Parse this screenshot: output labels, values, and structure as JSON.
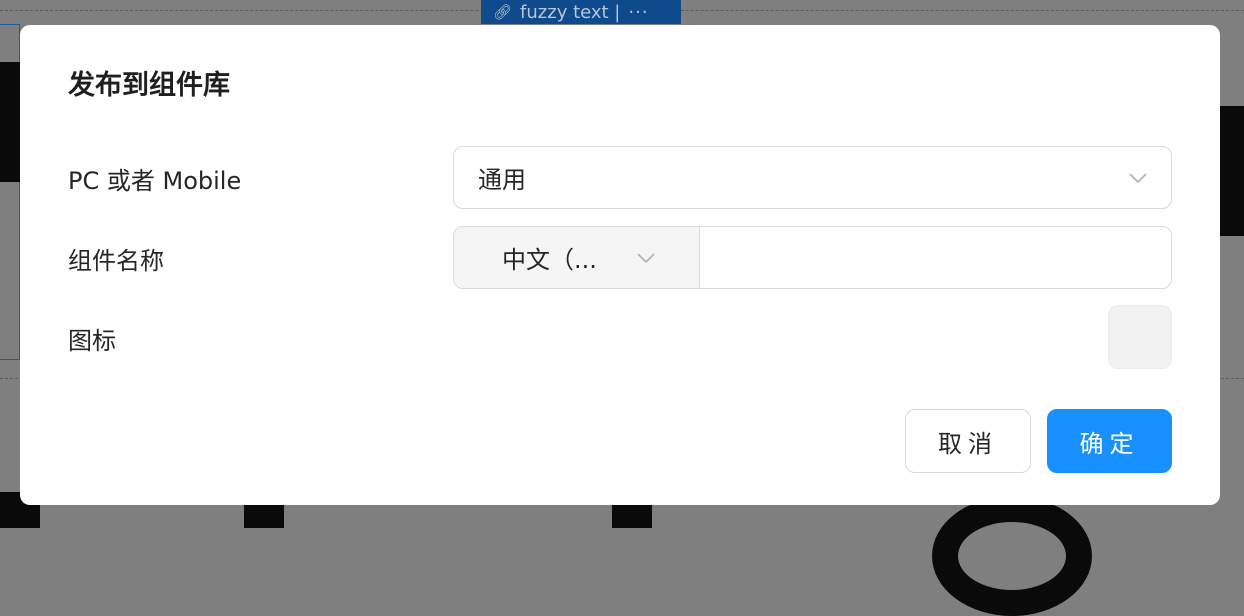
{
  "background": {
    "selection_tag": {
      "icon": "link-icon",
      "label": "fuzzy text |",
      "more": "···"
    }
  },
  "modal": {
    "title": "发布到组件库",
    "fields": {
      "platform": {
        "label": "PC 或者 Mobile",
        "value": "通用",
        "icon": "chevron-down-icon"
      },
      "component_name": {
        "label": "组件名称",
        "language_value": "中文（...",
        "input_value": "",
        "icon": "chevron-down-icon"
      },
      "icon": {
        "label": "图标"
      }
    },
    "buttons": {
      "cancel": "取消",
      "ok": "确定"
    }
  },
  "colors": {
    "primary": "#1890ff",
    "overlay": "#7f7f7f",
    "border": "#d9d9d9"
  }
}
